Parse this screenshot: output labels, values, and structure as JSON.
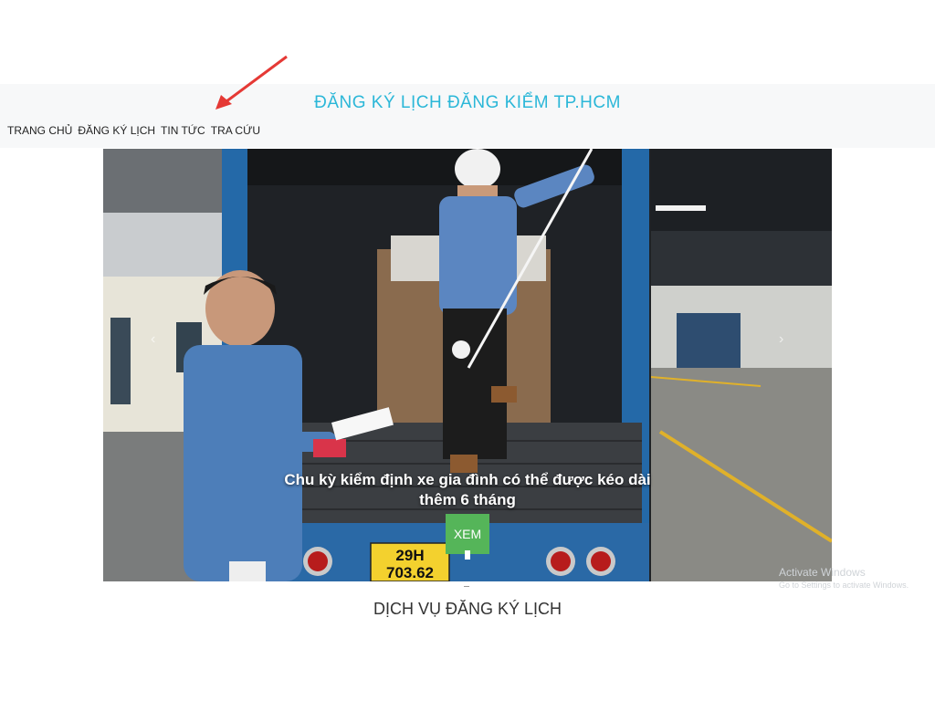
{
  "header": {
    "title": "ĐĂNG KÝ LỊCH ĐĂNG KIỂM TP.HCM",
    "nav": [
      "TRANG CHỦ",
      "ĐĂNG KÝ LỊCH",
      "TIN TỨC",
      "TRA CỨU"
    ]
  },
  "hero": {
    "caption_line1": "Chu kỳ kiểm định xe gia đình có thể được kéo dài",
    "caption_line2": "thêm 6 tháng",
    "button_label": "XEM",
    "plate_line1": "29H",
    "plate_line2": "703.62",
    "prev_icon": "‹",
    "next_icon": "›"
  },
  "section": {
    "title": "DỊCH VỤ ĐĂNG KÝ LỊCH"
  },
  "watermark": {
    "line1": "Activate Windows",
    "line2": "Go to Settings to activate Windows."
  },
  "colors": {
    "title": "#2bb7d8",
    "button": "#55b559",
    "header_bg": "#f7f8f9",
    "arrow": "#e53935"
  }
}
